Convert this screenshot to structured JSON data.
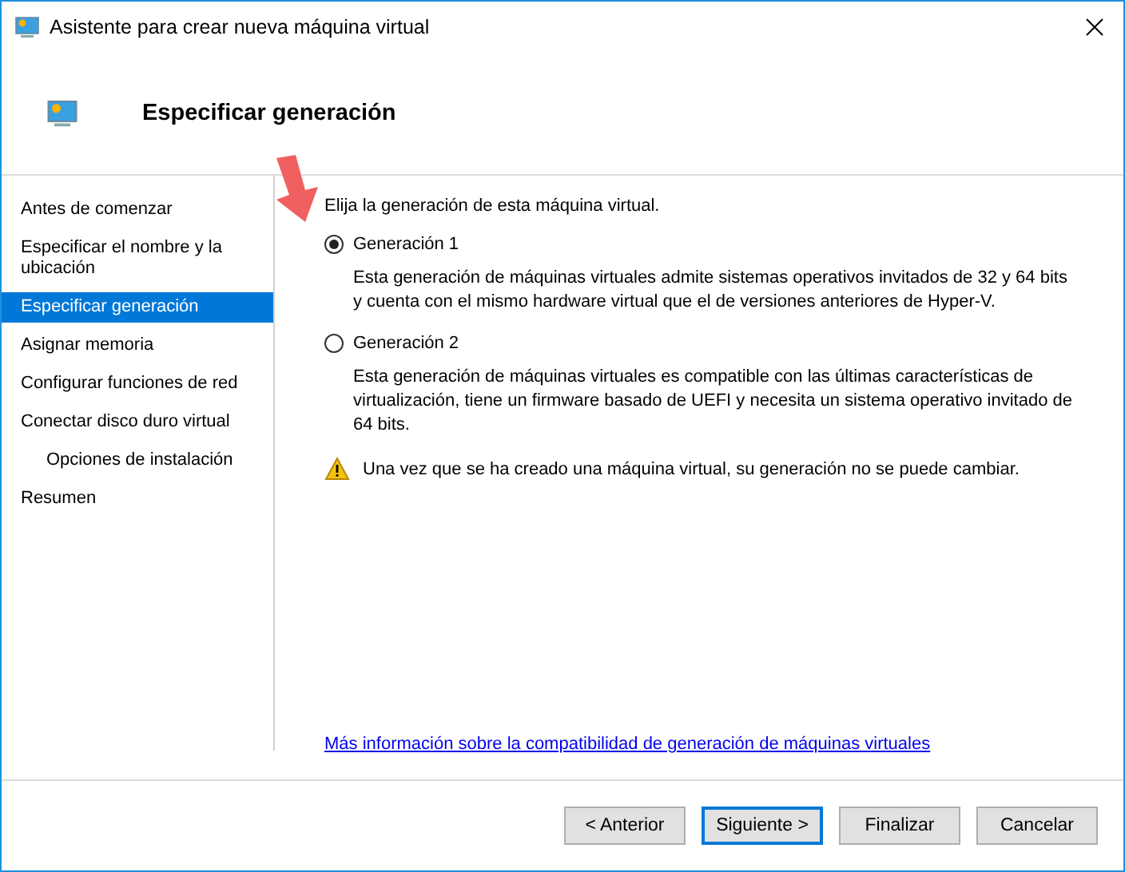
{
  "window": {
    "title": "Asistente para crear nueva máquina virtual"
  },
  "header": {
    "title": "Especificar generación"
  },
  "steps": [
    {
      "label": "Antes de comenzar",
      "selected": false
    },
    {
      "label": "Especificar el nombre y la ubicación",
      "selected": false
    },
    {
      "label": "Especificar generación",
      "selected": true
    },
    {
      "label": "Asignar memoria",
      "selected": false
    },
    {
      "label": "Configurar funciones de red",
      "selected": false
    },
    {
      "label": "Conectar disco duro virtual",
      "selected": false,
      "children": [
        {
          "label": "Opciones de instalación",
          "selected": false
        }
      ]
    },
    {
      "label": "Resumen",
      "selected": false
    }
  ],
  "prompt": "Elija la generación de esta máquina virtual.",
  "options": [
    {
      "label": "Generación 1",
      "selected": true,
      "description": "Esta generación de máquinas virtuales admite sistemas operativos invitados de 32 y 64 bits y cuenta con el mismo hardware virtual que el de versiones anteriores de Hyper-V."
    },
    {
      "label": "Generación 2",
      "selected": false,
      "description": "Esta generación de máquinas virtuales es compatible con las últimas características de virtualización, tiene un firmware basado de UEFI y necesita un sistema operativo invitado de 64 bits."
    }
  ],
  "warning": "Una vez que se ha creado una máquina virtual, su generación no se puede cambiar.",
  "link": "Más información sobre la compatibilidad de generación de máquinas virtuales",
  "buttons": [
    {
      "label": "< Anterior",
      "default": false
    },
    {
      "label": "Siguiente >",
      "default": true
    },
    {
      "label": "Finalizar",
      "default": false
    },
    {
      "label": "Cancelar",
      "default": false
    }
  ]
}
